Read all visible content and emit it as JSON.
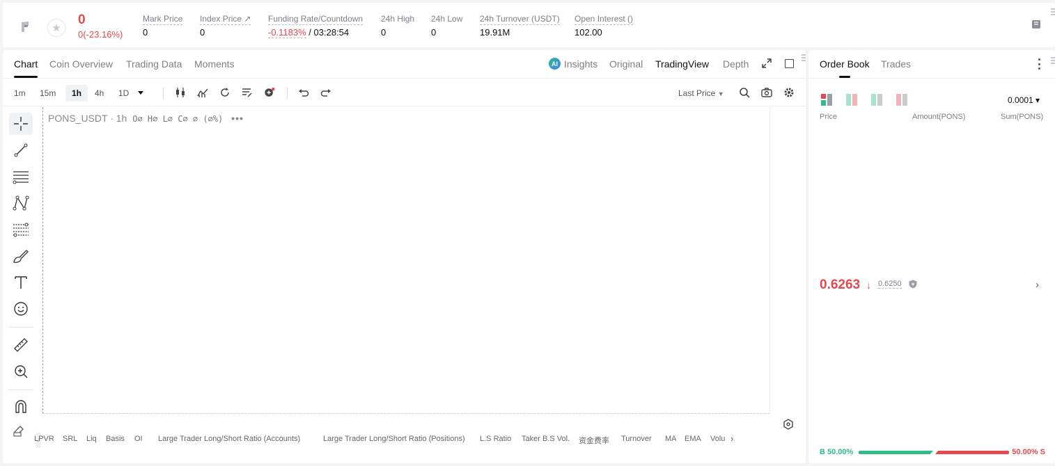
{
  "ticker": {
    "last_price": "0",
    "last_change": "0(-23.16%)",
    "stats": [
      {
        "label": "Mark Price",
        "value": "0"
      },
      {
        "label": "Index Price ↗",
        "value": "0"
      },
      {
        "label": "Funding Rate/Countdown",
        "rate": "-0.1183%",
        "countdown": " / 03:28:54"
      },
      {
        "label": "24h High",
        "value": "0"
      },
      {
        "label": "24h Low",
        "value": "0"
      },
      {
        "label": "24h Turnover (USDT)",
        "value": "19.91M"
      },
      {
        "label": "Open Interest ()",
        "value": "102.00"
      }
    ]
  },
  "chart_tabs": {
    "left": [
      "Chart",
      "Coin Overview",
      "Trading Data",
      "Moments"
    ],
    "right": [
      "Insights",
      "Original",
      "TradingView",
      "Depth"
    ],
    "ai_badge": "AI"
  },
  "toolbar": {
    "timeframes": [
      "1m",
      "15m",
      "1h",
      "4h",
      "1D"
    ],
    "active_timeframe": "1h",
    "price_source": "Last Price"
  },
  "legend": {
    "symbol": "PONS_USDT · 1h",
    "ohlc": "O∅ H∅ L∅ C∅ ∅ (∅%)",
    "more": "•••"
  },
  "indicators": [
    "LPVR",
    "SRL",
    "Liq",
    "Basis",
    "OI",
    "Large Trader Long/Short Ratio (Accounts)",
    "Large Trader Long/Short Ratio (Positions)",
    "L.S Ratio",
    "Taker B.S Vol.",
    "资金费率",
    "Turnover",
    "MA",
    "EMA",
    "Volu"
  ],
  "indicators_more": "›",
  "order_book": {
    "tabs": [
      "Order Book",
      "Trades"
    ],
    "precision": "0.0001 ▾",
    "headers": {
      "price": "Price",
      "amount": "Amount(PONS)",
      "sum": "Sum(PONS)"
    },
    "mid_price": "0.6263",
    "mid_arrow": "↓",
    "mark_price": "0.6250",
    "mid_chevron": "›",
    "buy_ratio": "B 50.00%",
    "sell_ratio": "50.00% S",
    "buy_fraction": 0.5
  },
  "colors": {
    "up": "#2dbd85",
    "down": "#e5484d",
    "text": "#111111",
    "muted": "#7b7f86"
  }
}
